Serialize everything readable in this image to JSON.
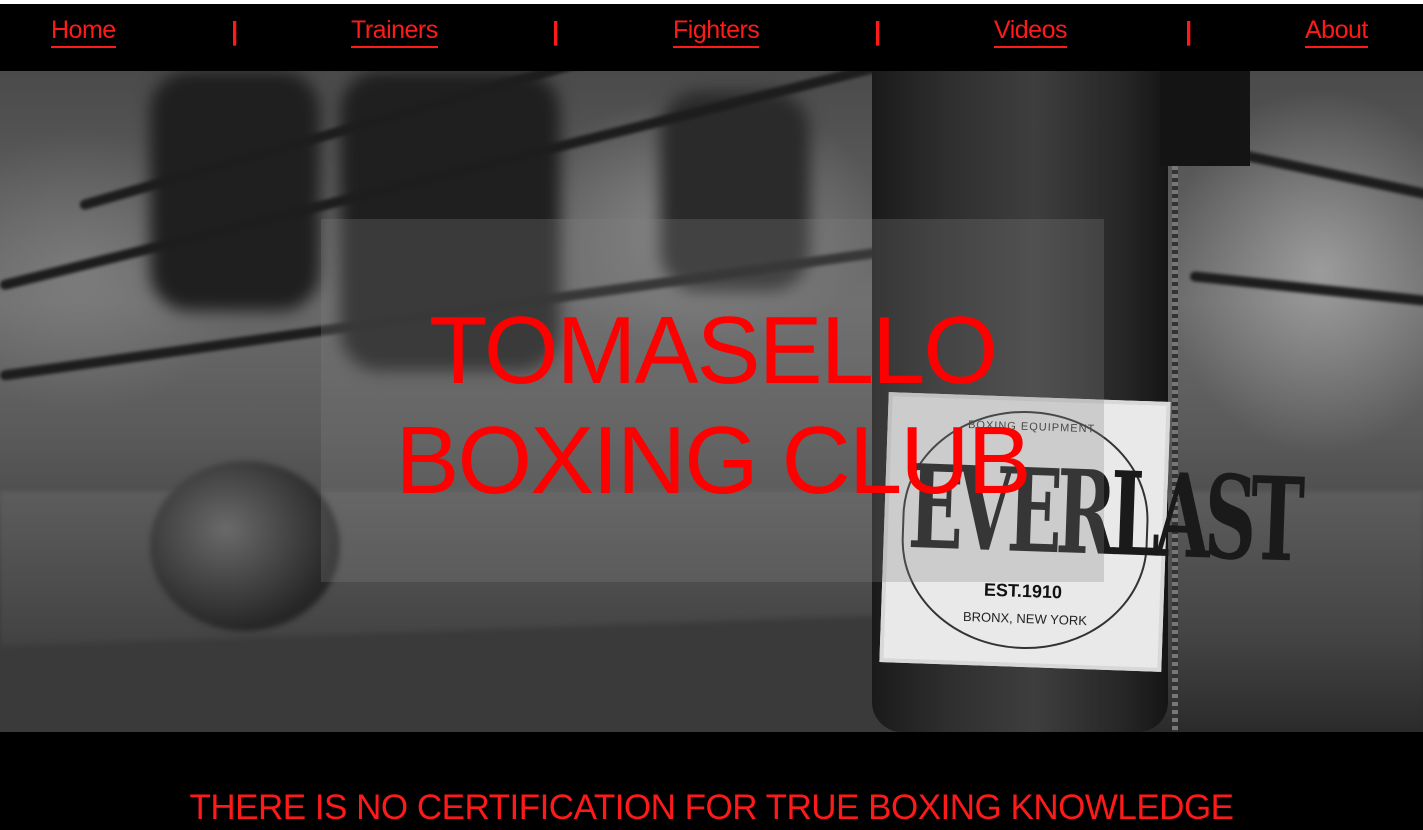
{
  "nav": {
    "items": [
      {
        "label": "Home"
      },
      {
        "label": "Trainers"
      },
      {
        "label": "Fighters"
      },
      {
        "label": "Videos"
      },
      {
        "label": "About"
      }
    ],
    "separator": "|"
  },
  "hero": {
    "title_line1": "TOMASELLO",
    "title_line2": "BOXING CLUB",
    "bag_brand": "EVERLAST",
    "bag_top": "BOXING EQUIPMENT",
    "bag_est": "EST.1910",
    "bag_bottom": "BRONX, NEW YORK"
  },
  "tagline": "THERE IS NO CERTIFICATION FOR TRUE BOXING KNOWLEDGE",
  "colors": {
    "accent": "#ff0000",
    "background": "#000000"
  }
}
